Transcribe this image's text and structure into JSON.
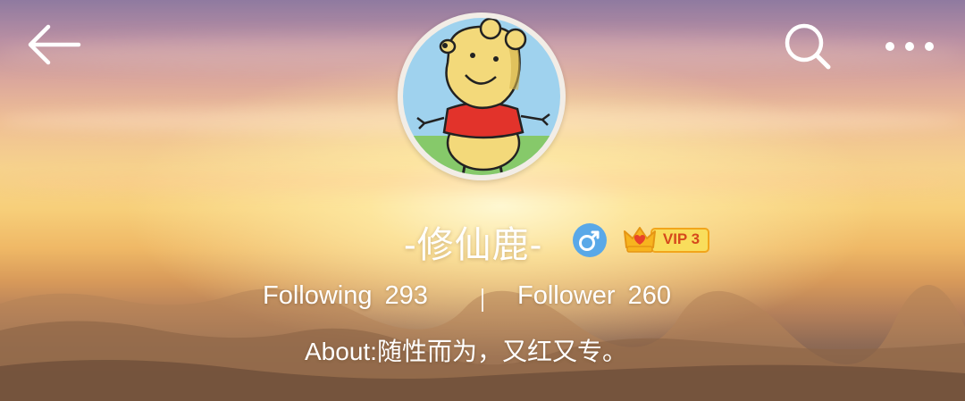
{
  "header": {
    "back_icon": "arrow-left-icon",
    "search_icon": "search-icon",
    "more_icon": "more-horizontal-icon"
  },
  "profile": {
    "avatar_icon": "cartoon-bear-avatar",
    "username": "-修仙鹿-",
    "gender_icon": "male-icon",
    "gender_color": "#59a8e8",
    "vip_icon": "crown-icon",
    "vip_label": "VIP 3",
    "vip_color": "#f7b41f",
    "following_label": "Following",
    "following_count": "293",
    "divider": "|",
    "follower_label": "Follower",
    "follower_count": "260",
    "about": "About:随性而为，又红又专。"
  }
}
